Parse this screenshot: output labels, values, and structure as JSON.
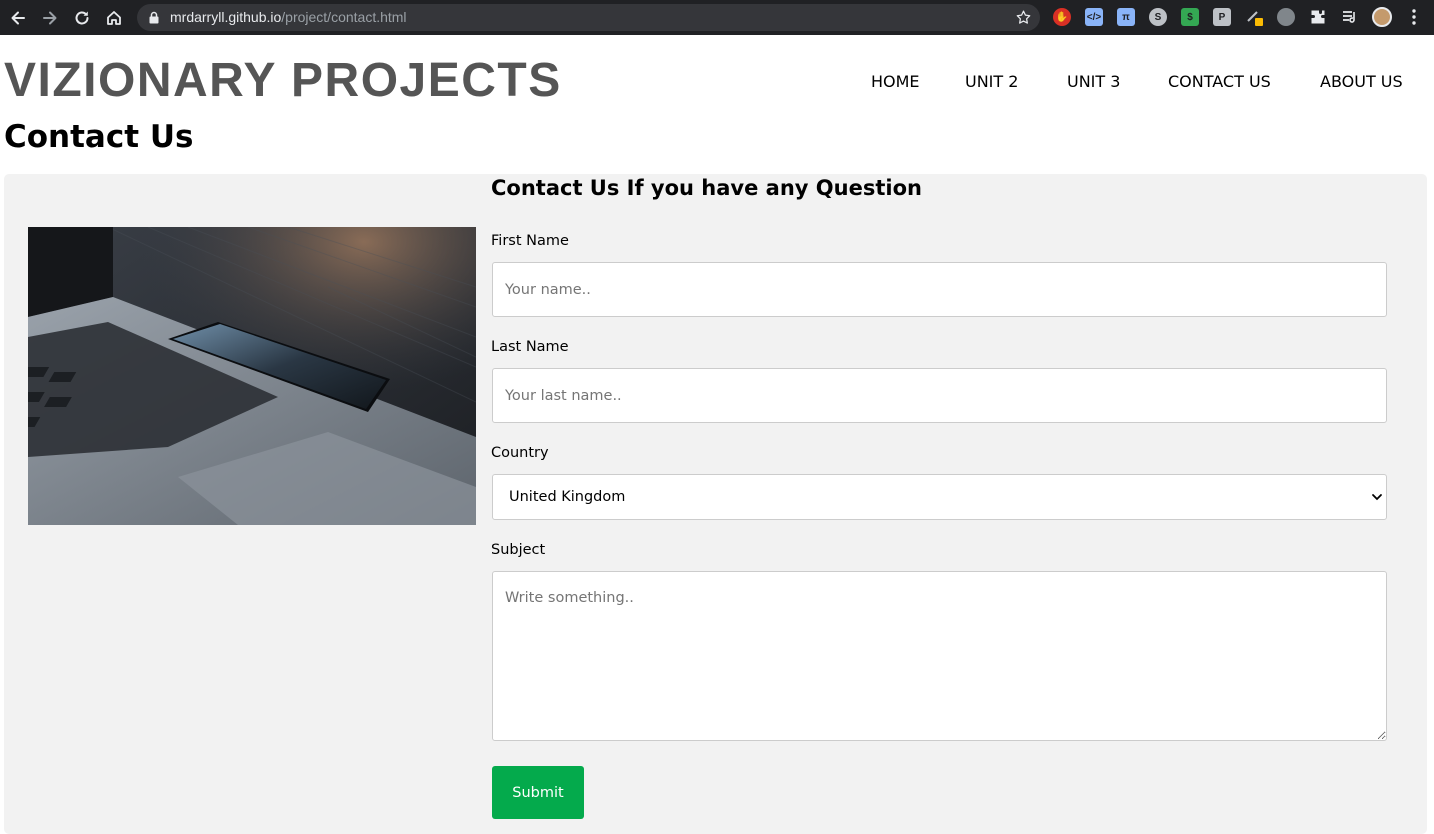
{
  "browser": {
    "url_host": "mrdarryll.github.io",
    "url_path": "/project/contact.html"
  },
  "site": {
    "title": "VIZIONARY PROJECTS",
    "nav": [
      "HOME",
      "UNIT 2",
      "UNIT 3",
      "CONTACT US",
      "ABOUT US"
    ]
  },
  "page": {
    "heading": "Contact Us"
  },
  "form": {
    "heading": "Contact Us If you have any Question",
    "first_name_label": "First Name",
    "first_name_placeholder": "Your name..",
    "last_name_label": "Last Name",
    "last_name_placeholder": "Your last name..",
    "country_label": "Country",
    "country_selected": "United Kingdom",
    "subject_label": "Subject",
    "subject_placeholder": "Write something..",
    "submit_label": "Submit"
  },
  "colors": {
    "submit_bg": "#04aa4c",
    "panel_bg": "#f2f2f2",
    "title_color": "#555555"
  }
}
